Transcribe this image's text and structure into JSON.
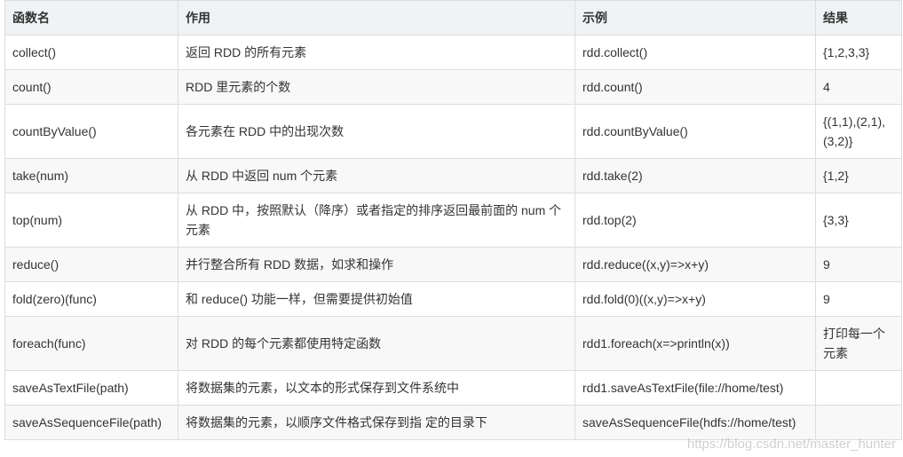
{
  "table": {
    "headers": [
      "函数名",
      "作用",
      "示例",
      "结果"
    ],
    "rows": [
      {
        "name": "collect()",
        "desc": "返回 RDD 的所有元素",
        "example": "rdd.collect()",
        "result": "{1,2,3,3}"
      },
      {
        "name": "count()",
        "desc": "RDD 里元素的个数",
        "example": "rdd.count()",
        "result": "4"
      },
      {
        "name": "countByValue()",
        "desc": "各元素在 RDD 中的出现次数",
        "example": "rdd.countByValue()",
        "result": "{(1,1),(2,1),(3,2)}"
      },
      {
        "name": "take(num)",
        "desc": "从 RDD 中返回 num 个元素",
        "example": "rdd.take(2)",
        "result": "{1,2}"
      },
      {
        "name": "top(num)",
        "desc": "从 RDD 中，按照默认（降序）或者指定的排序返回最前面的 num 个元素",
        "example": "rdd.top(2)",
        "result": "{3,3}"
      },
      {
        "name": "reduce()",
        "desc": "并行整合所有 RDD 数据，如求和操作",
        "example": "rdd.reduce((x,y)=>x+y)",
        "result": "9"
      },
      {
        "name": "fold(zero)(func)",
        "desc": "和 reduce() 功能一样，但需要提供初始值",
        "example": "rdd.fold(0)((x,y)=>x+y)",
        "result": "9"
      },
      {
        "name": "foreach(func)",
        "desc": "对 RDD 的每个元素都使用特定函数",
        "example": "rdd1.foreach(x=>println(x))",
        "result": "打印每一个元素"
      },
      {
        "name": "saveAsTextFile(path)",
        "desc": "将数据集的元素，以文本的形式保存到文件系统中",
        "example": "rdd1.saveAsTextFile(file://home/test)",
        "result": ""
      },
      {
        "name": "saveAsSequenceFile(path)",
        "desc": "将数据集的元素，以顺序文件格式保存到指 定的目录下",
        "example": "saveAsSequenceFile(hdfs://home/test)",
        "result": ""
      }
    ]
  },
  "watermark": "https://blog.csdn.net/master_hunter"
}
